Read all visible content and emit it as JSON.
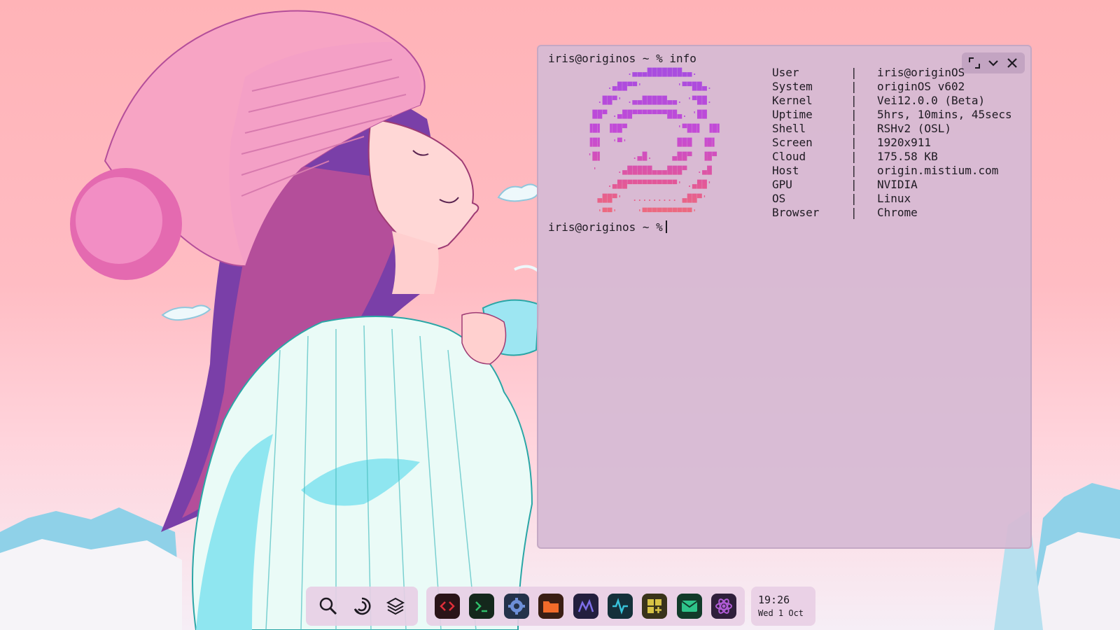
{
  "terminal": {
    "command_line": "iris@originos ~ % info",
    "prompt_line": "iris@originos ~ %",
    "ascii_logo": [
      "          .▄▄▄███████▄▄.          ",
      "      .▄██▀▀'       '▀▀██▄.      ",
      "    .██▀' .▄▄█████▄▄. '▀██.    ",
      "   ██▀ .▄██▀▀▀▀▀▀▀██▄. '██   ",
      "  ▐█▌ ▐██▀          '▀██▌ ▐█▌  ",
      "  ▐█▌  '▀'          ███  ▐█▌  ",
      "  '█▌      .▄█.    ▄██▀  ▐█▀  ",
      "   '    .▄█████▄▄▄███▀  .▄█   ",
      "      .▄██▀▀▀▀▀▀▀▀▀▀' .▄██'    ",
      "    ▄██▀'  ......... ▄██▀'      ",
      "    '▀▀'    '▀▀▀▀▀▀▀▀▀▀'        "
    ],
    "info": [
      {
        "key": "User",
        "sep": "|",
        "value": "iris@originOS"
      },
      {
        "key": "System",
        "sep": "|",
        "value": "originOS v602"
      },
      {
        "key": "Kernel",
        "sep": "|",
        "value": "Vei12.0.0 (Beta)"
      },
      {
        "key": "Uptime",
        "sep": "|",
        "value": "5hrs, 10mins, 45secs"
      },
      {
        "key": "Shell",
        "sep": "|",
        "value": "RSHv2 (OSL)"
      },
      {
        "key": "Screen",
        "sep": "|",
        "value": "1920x911"
      },
      {
        "key": "Cloud",
        "sep": "|",
        "value": "175.58 KB"
      },
      {
        "key": "Host",
        "sep": "|",
        "value": "origin.mistium.com"
      },
      {
        "key": "GPU",
        "sep": "|",
        "value": "NVIDIA"
      },
      {
        "key": "OS",
        "sep": "|",
        "value": "Linux"
      },
      {
        "key": "Browser",
        "sep": "|",
        "value": "Chrome"
      }
    ],
    "controls": [
      "resize-icon",
      "chevron-down-icon",
      "close-icon"
    ]
  },
  "dock": {
    "system": [
      "search-icon",
      "origin-swirl-icon",
      "layers-icon"
    ],
    "apps": [
      {
        "name": "code-editor-icon",
        "color": "#e02f3a"
      },
      {
        "name": "terminal-icon",
        "color": "#2fbf6a"
      },
      {
        "name": "settings-icon",
        "color": "#4a7bd1"
      },
      {
        "name": "files-icon",
        "color": "#f26b2a"
      },
      {
        "name": "monitor-chart-icon",
        "color": "#7d6ee8"
      },
      {
        "name": "activity-icon",
        "color": "#38c2d9"
      },
      {
        "name": "widgets-icon",
        "color": "#d7c245"
      },
      {
        "name": "mail-icon",
        "color": "#2ec48a"
      },
      {
        "name": "atom-icon",
        "color": "#b05cd6"
      }
    ],
    "clock": {
      "time": "19:26",
      "date": "Wed 1 Oct"
    }
  }
}
